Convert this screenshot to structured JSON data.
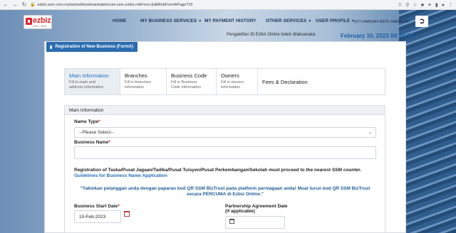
{
  "browser": {
    "url": "ezbiz.ssm.com.my/wicket/bookmarkable/com.ssm.ezbiz.robForm.EditRobFormAPage?15",
    "nav_icons": [
      "back-icon",
      "forward-icon",
      "reload-icon"
    ],
    "toolbar_icons": [
      "share-icon",
      "zoom-icon",
      "star-icon",
      "extension-icon",
      "puzzle-icon",
      "sidebar-icon",
      "profile-icon",
      "menu-icon"
    ]
  },
  "header": {
    "logo_text": "ezbiz",
    "logo_sub": "ONLINE",
    "menu": [
      {
        "label": "HOME",
        "dropdown": false
      },
      {
        "label": "MY BUSINESS SERVICES",
        "dropdown": true
      },
      {
        "label": "MY PAYMENT HISTORY",
        "dropdown": false
      },
      {
        "label": "OTHER SERVICES",
        "dropdown": true
      },
      {
        "label": "USER PROFILE",
        "dropdown": true
      }
    ],
    "user_name": "SITI HABSAH BINTI HAMSURI",
    "notice": "Pengaktifan ID Ezbiz Online boleh dilaksanaka",
    "date": "February 10, 2023 04:34:09"
  },
  "registration_tab": "Registration of New Business (FormA)",
  "wizard": [
    {
      "title": "Main Information",
      "desc1": "Fill in main and",
      "desc2": "address information",
      "active": true
    },
    {
      "title": "Branches",
      "desc1": "Fill in branches",
      "desc2": "information",
      "active": false
    },
    {
      "title": "Business Code",
      "desc1": "Fill in Business",
      "desc2": "Code information",
      "active": false
    },
    {
      "title": "Owners",
      "desc1": "Fill in owners",
      "desc2": "information",
      "active": false
    },
    {
      "title": "Fees & Declaration",
      "desc1": "",
      "desc2": "",
      "active": false
    }
  ],
  "form": {
    "section_title": "Main Information",
    "name_type_label": "Name Type",
    "name_type_value": "--Please Select--",
    "business_name_label": "Business Name",
    "business_name_value": "",
    "required_mark": "*",
    "ssm_notice": "Registration of Taska/Pusat Jagaan/Tadika/Pusat Tuisyen/Pusat Perkembangan/Sekolah must proceed to the nearest SSM counter.",
    "guidelines_link": "Guidelines for Business Name Application",
    "biztrust_line1": "\"Yakinkan pelanggan anda dengan paparan kod QR SSM BizTrust pada platform perniagaan anda! Muat turun kod QR SSM BizTrust",
    "biztrust_line2": "secara  PERCUMA di Ezbiz Online.\"",
    "start_date_label": "Business Start Date",
    "start_date_value": "10-Feb-2023",
    "partnership_label_1": "Partnership Agreement Date",
    "partnership_label_2": "(if applicable)",
    "partnership_value": ""
  }
}
